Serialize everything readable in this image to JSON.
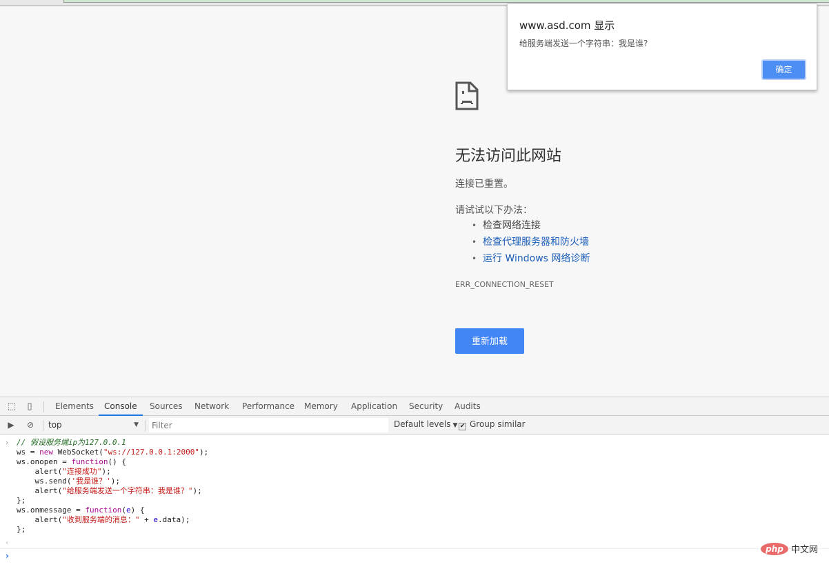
{
  "browser": {
    "error_page": {
      "icon": "sad-page-icon",
      "title": "无法访问此网站",
      "subtitle": "连接已重置。",
      "try_label": "请试试以下办法：",
      "suggestions": [
        {
          "label": "检查网络连接",
          "link": false
        },
        {
          "label": "检查代理服务器和防火墙",
          "link": true
        },
        {
          "label": "运行 Windows 网络诊断",
          "link": true
        }
      ],
      "error_code": "ERR_CONNECTION_RESET",
      "reload_label": "重新加载"
    },
    "alert_dialog": {
      "title": "www.asd.com 显示",
      "message": "给服务端发送一个字符串：我是谁?",
      "ok_label": "确定"
    }
  },
  "devtools": {
    "tabs": [
      "Elements",
      "Console",
      "Sources",
      "Network",
      "Performance",
      "Memory",
      "Application",
      "Security",
      "Audits"
    ],
    "active_tab": "Console",
    "toolbar": {
      "context": "top",
      "filter_placeholder": "Filter",
      "levels_label": "Default levels",
      "group_similar_label": "Group similar",
      "group_similar_checked": true
    },
    "console": {
      "code_lines": [
        "// 假设服务端ip为127.0.0.1",
        "ws = new WebSocket(\"ws://127.0.0.1:2000\");",
        "ws.onopen = function() {",
        "    alert(\"连接成功\");",
        "    ws.send('我是谁？');",
        "    alert(\"给服务端发送一个字符串：我是谁？\");",
        "};",
        "ws.onmessage = function(e) {",
        "    alert(\"收到服务端的消息：\" + e.data);",
        "};"
      ]
    }
  },
  "watermark": {
    "logo": "php",
    "text": "中文网"
  }
}
